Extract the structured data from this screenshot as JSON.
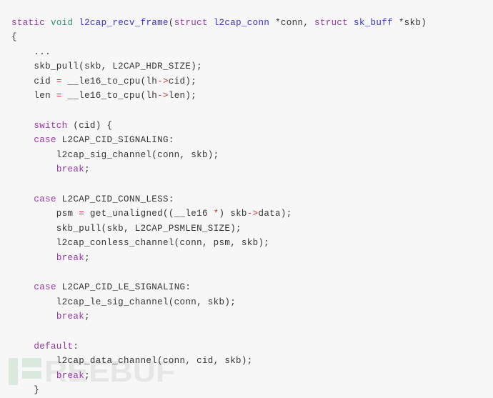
{
  "viewer": {
    "title": "l2cap_recv_frame source listing",
    "language": "c",
    "background_color": "#f7f7f7",
    "default_text_color": "#333333"
  },
  "palette": {
    "keyword": "#9933aa",
    "type": "#2e9166",
    "function": "#3333cc",
    "operator": "#cc3333",
    "plain": "#333333",
    "watermark_text": "#e6e6e6",
    "watermark_mark": "#dbe8de"
  },
  "watermark": {
    "text": "REEBUF",
    "full_name": "FREEBUF"
  },
  "code": {
    "lines": [
      {
        "n": 1,
        "tokens": [
          {
            "t": "static",
            "c": "kw"
          },
          {
            "t": " ",
            "c": "plain"
          },
          {
            "t": "void",
            "c": "type"
          },
          {
            "t": " ",
            "c": "plain"
          },
          {
            "t": "l2cap_recv_frame",
            "c": "fn"
          },
          {
            "t": "(",
            "c": "plain"
          },
          {
            "t": "struct",
            "c": "kw"
          },
          {
            "t": " ",
            "c": "plain"
          },
          {
            "t": "l2cap_conn",
            "c": "fn"
          },
          {
            "t": " ",
            "c": "plain"
          },
          {
            "t": "*conn, ",
            "c": "plain"
          },
          {
            "t": "struct",
            "c": "kw"
          },
          {
            "t": " ",
            "c": "plain"
          },
          {
            "t": "sk_buff",
            "c": "fn"
          },
          {
            "t": " ",
            "c": "plain"
          },
          {
            "t": "*skb)",
            "c": "plain"
          }
        ]
      },
      {
        "n": 2,
        "tokens": [
          {
            "t": "{",
            "c": "plain"
          }
        ]
      },
      {
        "n": 3,
        "tokens": [
          {
            "t": "    ...",
            "c": "plain"
          }
        ]
      },
      {
        "n": 4,
        "tokens": [
          {
            "t": "    skb_pull(skb, L2CAP_HDR_SIZE);",
            "c": "plain"
          }
        ]
      },
      {
        "n": 5,
        "tokens": [
          {
            "t": "    cid ",
            "c": "plain"
          },
          {
            "t": "=",
            "c": "op"
          },
          {
            "t": " __le16_to_cpu(lh",
            "c": "plain"
          },
          {
            "t": "->",
            "c": "op"
          },
          {
            "t": "cid);",
            "c": "plain"
          }
        ]
      },
      {
        "n": 6,
        "tokens": [
          {
            "t": "    len ",
            "c": "plain"
          },
          {
            "t": "=",
            "c": "op"
          },
          {
            "t": " __le16_to_cpu(lh",
            "c": "plain"
          },
          {
            "t": "->",
            "c": "op"
          },
          {
            "t": "len);",
            "c": "plain"
          }
        ]
      },
      {
        "n": 7,
        "tokens": [
          {
            "t": "",
            "c": "plain"
          }
        ]
      },
      {
        "n": 8,
        "tokens": [
          {
            "t": "    ",
            "c": "plain"
          },
          {
            "t": "switch",
            "c": "kw"
          },
          {
            "t": " (cid) {",
            "c": "plain"
          }
        ]
      },
      {
        "n": 9,
        "tokens": [
          {
            "t": "    ",
            "c": "plain"
          },
          {
            "t": "case",
            "c": "kw"
          },
          {
            "t": " L2CAP_CID_SIGNALING:",
            "c": "plain"
          }
        ]
      },
      {
        "n": 10,
        "tokens": [
          {
            "t": "        l2cap_sig_channel(conn, skb);",
            "c": "plain"
          }
        ]
      },
      {
        "n": 11,
        "tokens": [
          {
            "t": "        ",
            "c": "plain"
          },
          {
            "t": "break",
            "c": "kw"
          },
          {
            "t": ";",
            "c": "plain"
          }
        ]
      },
      {
        "n": 12,
        "tokens": [
          {
            "t": "",
            "c": "plain"
          }
        ]
      },
      {
        "n": 13,
        "tokens": [
          {
            "t": "    ",
            "c": "plain"
          },
          {
            "t": "case",
            "c": "kw"
          },
          {
            "t": " L2CAP_CID_CONN_LESS:",
            "c": "plain"
          }
        ]
      },
      {
        "n": 14,
        "tokens": [
          {
            "t": "        psm ",
            "c": "plain"
          },
          {
            "t": "=",
            "c": "op"
          },
          {
            "t": " get_unaligned((__le16 ",
            "c": "plain"
          },
          {
            "t": "*",
            "c": "op"
          },
          {
            "t": ") skb",
            "c": "plain"
          },
          {
            "t": "->",
            "c": "op"
          },
          {
            "t": "data);",
            "c": "plain"
          }
        ]
      },
      {
        "n": 15,
        "tokens": [
          {
            "t": "        skb_pull(skb, L2CAP_PSMLEN_SIZE);",
            "c": "plain"
          }
        ]
      },
      {
        "n": 16,
        "tokens": [
          {
            "t": "        l2cap_conless_channel(conn, psm, skb);",
            "c": "plain"
          }
        ]
      },
      {
        "n": 17,
        "tokens": [
          {
            "t": "        ",
            "c": "plain"
          },
          {
            "t": "break",
            "c": "kw"
          },
          {
            "t": ";",
            "c": "plain"
          }
        ]
      },
      {
        "n": 18,
        "tokens": [
          {
            "t": "",
            "c": "plain"
          }
        ]
      },
      {
        "n": 19,
        "tokens": [
          {
            "t": "    ",
            "c": "plain"
          },
          {
            "t": "case",
            "c": "kw"
          },
          {
            "t": " L2CAP_CID_LE_SIGNALING:",
            "c": "plain"
          }
        ]
      },
      {
        "n": 20,
        "tokens": [
          {
            "t": "        l2cap_le_sig_channel(conn, skb);",
            "c": "plain"
          }
        ]
      },
      {
        "n": 21,
        "tokens": [
          {
            "t": "        ",
            "c": "plain"
          },
          {
            "t": "break",
            "c": "kw"
          },
          {
            "t": ";",
            "c": "plain"
          }
        ]
      },
      {
        "n": 22,
        "tokens": [
          {
            "t": "",
            "c": "plain"
          }
        ]
      },
      {
        "n": 23,
        "tokens": [
          {
            "t": "    ",
            "c": "plain"
          },
          {
            "t": "default",
            "c": "kw"
          },
          {
            "t": ":",
            "c": "plain"
          }
        ]
      },
      {
        "n": 24,
        "tokens": [
          {
            "t": "        l2cap_data_channel(conn, cid, skb);",
            "c": "plain"
          }
        ]
      },
      {
        "n": 25,
        "tokens": [
          {
            "t": "        ",
            "c": "plain"
          },
          {
            "t": "break",
            "c": "kw"
          },
          {
            "t": ";",
            "c": "plain"
          }
        ]
      },
      {
        "n": 26,
        "tokens": [
          {
            "t": "    }",
            "c": "plain"
          }
        ]
      }
    ]
  }
}
